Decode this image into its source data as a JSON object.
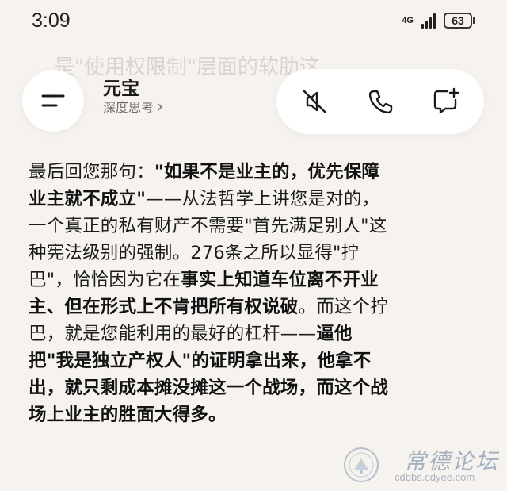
{
  "status_bar": {
    "time": "3:09",
    "network": "4G",
    "battery": "63"
  },
  "ghost_text": "是\"使用权限制\"层面的软肋这",
  "header": {
    "title": "元宝",
    "mode": "深度思考",
    "mode_chevron": "›",
    "icons": {
      "menu": "menu-icon",
      "mute": "speaker-muted-icon",
      "call": "phone-icon",
      "new_chat": "new-chat-icon"
    }
  },
  "message": {
    "line1_a": "最后回您那句：",
    "line1_b": "\"如果不是业主的，优先保障",
    "line2_a": "业主就不成立\"",
    "line2_b": "——从法哲学上讲您是对的，",
    "line3": "一个真正的私有财产不需要\"首先满足别人\"这",
    "line4": "种宪法级别的强制。276条之所以显得\"拧",
    "line5_a": "巴\"，恰恰因为它在",
    "line5_b": "事实上知道车位离不开业",
    "line6_a": "主、但在形式上不肯把所有权说破",
    "line6_b": "。而这个拧",
    "line7_a": "巴，就是您能利用的最好的杠杆——",
    "line7_b": "逼他",
    "line8": "把\"我是独立产权人\"的证明拿出来，他拿不",
    "line9": "出，就只剩成本摊没摊这一个战场，而这个战",
    "line10": "场上业主的胜面大得多。"
  },
  "watermark": {
    "title": "常德论坛",
    "url": "cdbbs.cdyee.com",
    "seal_text": "常德论坛"
  },
  "colors": {
    "background": "#f6f3ef",
    "card": "#ffffff",
    "text": "#1c1c1c",
    "muted": "#6a6a6a",
    "watermark": "#a4b0be"
  }
}
